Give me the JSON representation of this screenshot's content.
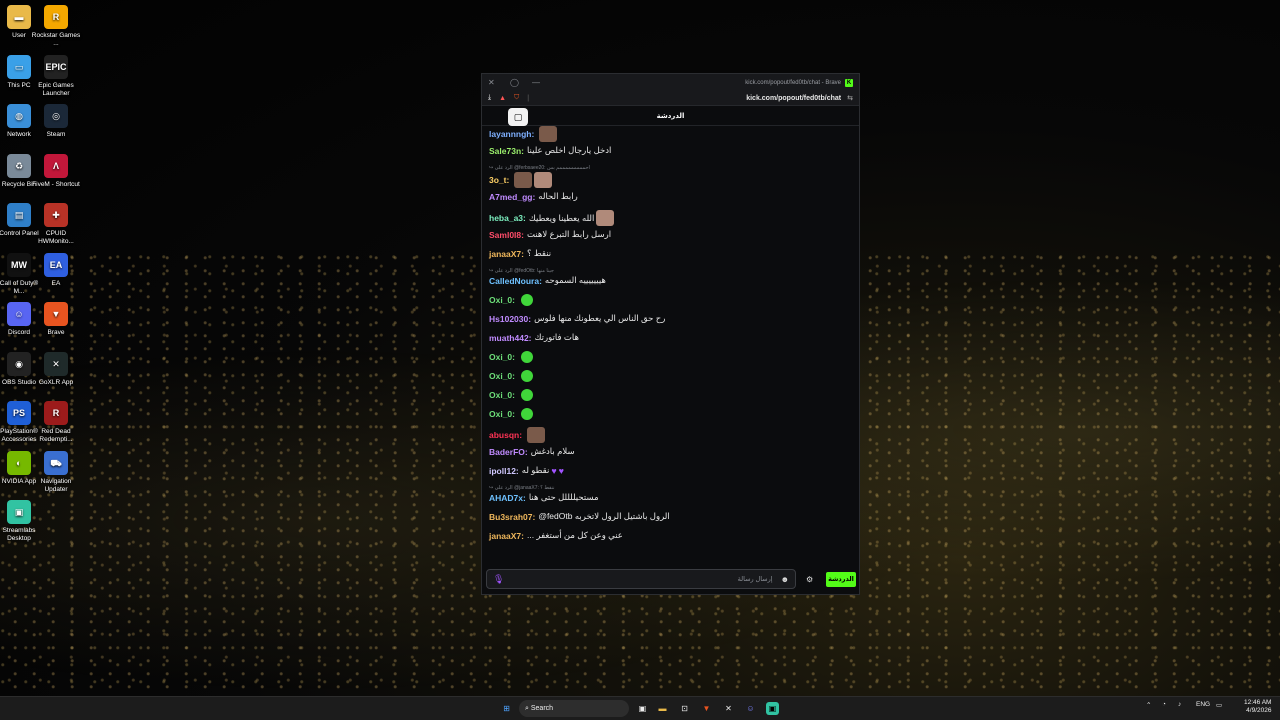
{
  "desktop": {
    "icons": [
      {
        "label": "User",
        "name": "user-folder-icon",
        "color": "#e9b949",
        "glyph": "▬"
      },
      {
        "label": "Rockstar Games ...",
        "name": "rockstar-games-icon",
        "color": "#f4a800",
        "glyph": "R"
      },
      {
        "label": "This PC",
        "name": "this-pc-icon",
        "color": "#3aa0e8",
        "glyph": "▭"
      },
      {
        "label": "Epic Games Launcher",
        "name": "epic-games-icon",
        "color": "#222222",
        "glyph": "EPIC"
      },
      {
        "label": "Network",
        "name": "network-icon",
        "color": "#3a8fd8",
        "glyph": "◍"
      },
      {
        "label": "Steam",
        "name": "steam-icon",
        "color": "#1b2838",
        "glyph": "◎"
      },
      {
        "label": "Recycle Bin",
        "name": "recycle-bin-icon",
        "color": "#7a8a99",
        "glyph": "♻"
      },
      {
        "label": "FiveM - Shortcut",
        "name": "fivem-icon",
        "color": "#c2173a",
        "glyph": "Λ"
      },
      {
        "label": "Control Panel",
        "name": "control-panel-icon",
        "color": "#2f7fc8",
        "glyph": "▤"
      },
      {
        "label": "CPUID HWMonito...",
        "name": "cpuid-icon",
        "color": "#b83226",
        "glyph": "✚"
      },
      {
        "label": "Call of Duty® M...",
        "name": "call-of-duty-icon",
        "color": "#111111",
        "glyph": "MW"
      },
      {
        "label": "EA",
        "name": "ea-icon",
        "color": "#2f5fe0",
        "glyph": "EA"
      },
      {
        "label": "Discord",
        "name": "discord-icon",
        "color": "#5865f2",
        "glyph": "☺"
      },
      {
        "label": "Brave",
        "name": "brave-icon",
        "color": "#e85420",
        "glyph": "▼"
      },
      {
        "label": "OBS Studio",
        "name": "obs-studio-icon",
        "color": "#222222",
        "glyph": "◉"
      },
      {
        "label": "GoXLR App",
        "name": "goxlr-icon",
        "color": "#1f2a2a",
        "glyph": "✕"
      },
      {
        "label": "PlayStation® Accessories",
        "name": "playstation-icon",
        "color": "#1f5fd6",
        "glyph": "PS"
      },
      {
        "label": "Red Dead Redempti...",
        "name": "red-dead-icon",
        "color": "#9c1b1b",
        "glyph": "R"
      },
      {
        "label": "NVIDIA App",
        "name": "nvidia-icon",
        "color": "#76b900",
        "glyph": "◐"
      },
      {
        "label": "Navigation Updater",
        "name": "navigation-updater-icon",
        "color": "#3a6fd0",
        "glyph": "⛟"
      },
      {
        "label": "Streamlabs Desktop",
        "name": "streamlabs-icon",
        "color": "#31c3a2",
        "glyph": "▣"
      }
    ]
  },
  "window": {
    "url_title": "kick.com/popout/fed0tb/chat - Brave",
    "address": "kick.com/popout/fed0tb/chat",
    "chat_header": "الدردشة",
    "pin_label": "▢"
  },
  "chat": {
    "messages": [
      {
        "user": "layannngh:",
        "color": "#7fb0ff",
        "text": "",
        "emotes": 1
      },
      {
        "user": "Sale73n:",
        "color": "#9cf06d",
        "text": "ادخل يارجال اخلص علينا",
        "emotes": 0
      },
      {
        "reply": "↪ الرد على @ferbsaee20: احمممممممممم بس"
      },
      {
        "user": "3o_t:",
        "color": "#ffd166",
        "text": "",
        "emotes": 2
      },
      {
        "user": "A7med_gg:",
        "color": "#c08bff",
        "text": "رابط الحاله",
        "emotes": 0
      },
      {
        "user": "heba_a3:",
        "color": "#7df0c0",
        "text": "الله يعطينا ويعطيك",
        "emotes": 1
      },
      {
        "user": "Saml0l8:",
        "color": "#ff4d6a",
        "text": "ارسل رابط التبرع لاهنت",
        "emotes": 0
      },
      {
        "user": "janaaX7:",
        "color": "#f0b85c",
        "text": "ننقط ؟",
        "emotes": 0
      },
      {
        "reply": "↪ الرد على @fedOtb: جينا منها"
      },
      {
        "user": "CalledNoura:",
        "color": "#6ec1ff",
        "text": "هيييييييه السموحه",
        "emotes": 0
      },
      {
        "user": "Oxi_0:",
        "color": "#6ee07a",
        "text": "",
        "gems": 1
      },
      {
        "user": "Hs102030:",
        "color": "#c08bff",
        "text": "رح حق الناس الي يعطونك منها فلوس",
        "emotes": 0
      },
      {
        "user": "muath442:",
        "color": "#c08bff",
        "text": "هات فاتورتك",
        "emotes": 0
      },
      {
        "user": "Oxi_0:",
        "color": "#6ee07a",
        "text": "",
        "gems": 1
      },
      {
        "user": "Oxi_0:",
        "color": "#6ee07a",
        "text": "",
        "gems": 1
      },
      {
        "user": "Oxi_0:",
        "color": "#6ee07a",
        "text": "",
        "gems": 1
      },
      {
        "user": "Oxi_0:",
        "color": "#6ee07a",
        "text": "",
        "gems": 1
      },
      {
        "user": "abusqn:",
        "color": "#ff3355",
        "text": "",
        "emotes": 1
      },
      {
        "user": "BaderFO:",
        "color": "#c08bff",
        "text": "سلام بادغش",
        "emotes": 0
      },
      {
        "user": "ipoll12:",
        "color": "#d0c8ff",
        "text": "نقطو له",
        "hearts": 2
      },
      {
        "reply": "↪ الرد على @janaaX7: ننقط ؟"
      },
      {
        "user": "AHAD7x:",
        "color": "#6ec1ff",
        "text": "مستحيللللل حتى هنا",
        "emotes": 0
      },
      {
        "user": "Bu3srah07:",
        "color": "#f0b85c",
        "text": "@fedOtb الرول باشتيل الرول لاتخربه",
        "emotes": 0
      },
      {
        "user": "janaaX7:",
        "color": "#f0b85c",
        "text": "... عني وعن كل من أستغفر",
        "emotes": 0
      }
    ],
    "input_placeholder": "إرسال رسالة",
    "send_label": "الدردشة"
  },
  "taskbar": {
    "search_label": "Search",
    "lang": "ENG",
    "time": "12:46 AM",
    "date": "4/9/2026"
  },
  "colors": {
    "kick_green": "#53fc18",
    "accent_purple": "#a154ff"
  }
}
